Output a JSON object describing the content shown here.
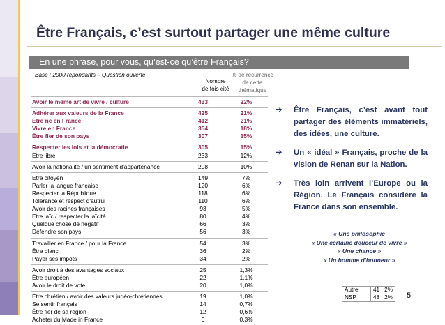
{
  "slide": {
    "title": "Être Français, c’est surtout partager une même culture",
    "question": "En une phrase, pour vous, qu’est-ce qu’être Français?",
    "base_note": "Base : 2000 répondants – Question ouverte",
    "page_number": "5"
  },
  "columns": {
    "count_line1": "Nombre",
    "count_line2": "de fois cité",
    "pct_line1": "% de récurrence",
    "pct_line2": "de cette",
    "pct_line3": "thématique"
  },
  "groups": [
    {
      "rows": [
        {
          "label": "Avoir le même art de vivre / culture",
          "count": "433",
          "pct": "22%",
          "highlight": true
        }
      ]
    },
    {
      "rows": [
        {
          "label": "Adhérer aux valeurs de la France",
          "count": "425",
          "pct": "21%",
          "highlight": true
        },
        {
          "label": "Etre né en France",
          "count": "412",
          "pct": "21%",
          "highlight": true
        },
        {
          "label": "Vivre en France",
          "count": "354",
          "pct": "18%",
          "highlight": true
        },
        {
          "label": "Être fier de son pays",
          "count": "307",
          "pct": "15%",
          "highlight": true
        }
      ]
    },
    {
      "rows": [
        {
          "label": "Respecter les lois et la démocratie",
          "count": "305",
          "pct": "15%",
          "highlight": true
        },
        {
          "label": "Etre libre",
          "count": "233",
          "pct": "12%",
          "highlight": false
        }
      ]
    },
    {
      "rows": [
        {
          "label": "Avoir la nationalité / un sentiment d'appartenance",
          "count": "208",
          "pct": "10%",
          "highlight": false
        }
      ]
    },
    {
      "rows": [
        {
          "label": "Etre citoyen",
          "count": "149",
          "pct": "7%",
          "highlight": false
        },
        {
          "label": "Parler la langue française",
          "count": "120",
          "pct": "6%",
          "highlight": false
        },
        {
          "label": "Respecter la République",
          "count": "118",
          "pct": "6%",
          "highlight": false
        },
        {
          "label": "Tolérance et respect d'autrui",
          "count": "110",
          "pct": "6%",
          "highlight": false
        },
        {
          "label": "Avoir des racines françaises",
          "count": "93",
          "pct": "5%",
          "highlight": false
        },
        {
          "label": "Etre laïc / respecter la laïcité",
          "count": "80",
          "pct": "4%",
          "highlight": false
        },
        {
          "label": "Quelque chose de négatif",
          "count": "66",
          "pct": "3%",
          "highlight": false
        },
        {
          "label": "Défendre son pays",
          "count": "56",
          "pct": "3%",
          "highlight": false
        }
      ]
    },
    {
      "rows": [
        {
          "label": "Travailler en France / pour la France",
          "count": "54",
          "pct": "3%",
          "highlight": false
        },
        {
          "label": "Être blanc",
          "count": "36",
          "pct": "2%",
          "highlight": false
        },
        {
          "label": "Payer ses impôts",
          "count": "34",
          "pct": "2%",
          "highlight": false
        }
      ]
    },
    {
      "rows": [
        {
          "label": "Avoir droit à des avantages sociaux",
          "count": "25",
          "pct": "1,3%",
          "highlight": false
        },
        {
          "label": "Être européen",
          "count": "22",
          "pct": "1,1%",
          "highlight": false
        },
        {
          "label": "Avoir le droit de vote",
          "count": "20",
          "pct": "1,0%",
          "highlight": false
        }
      ]
    },
    {
      "rows": [
        {
          "label": "Être chrétien / avoir des valeurs judéo-chrétiennes",
          "count": "19",
          "pct": "1,0%",
          "highlight": false
        },
        {
          "label": "Se sentir français",
          "count": "14",
          "pct": "0,7%",
          "highlight": false
        },
        {
          "label": "Être fier de sa région",
          "count": "12",
          "pct": "0,6%",
          "highlight": false
        },
        {
          "label": "Acheter du Made in France",
          "count": "6",
          "pct": "0,3%",
          "highlight": false
        }
      ]
    }
  ],
  "bullets": [
    "Être Français, c’est avant tout partager des éléments immatériels, des idées, une culture.",
    "Un « idéal » Français, proche de la vision de Renan sur la Nation.",
    "Très loin arrivent l’Europe ou la Région. Le Français considère la France dans son ensemble."
  ],
  "bullet_arrow": "➔",
  "quotes": [
    "« Une philosophie",
    "« Une certaine douceur de vivre »",
    "« Une chance »",
    "« Un homme d'honneur »"
  ],
  "mini_table": [
    {
      "label": "Autre",
      "count": "41",
      "pct": "2%"
    },
    {
      "label": "NSP",
      "count": "48",
      "pct": "2%"
    }
  ],
  "colors": {
    "highlight": "#8e2a52",
    "title": "#2f2f4f",
    "bullet_text": "#2a3560",
    "band": "#7a7a7a",
    "left_bar": [
      "#e9e4f2",
      "#d9d1e8",
      "#c7bcdc",
      "#b6a9d1",
      "#a797c5",
      "#f2c94c"
    ]
  }
}
